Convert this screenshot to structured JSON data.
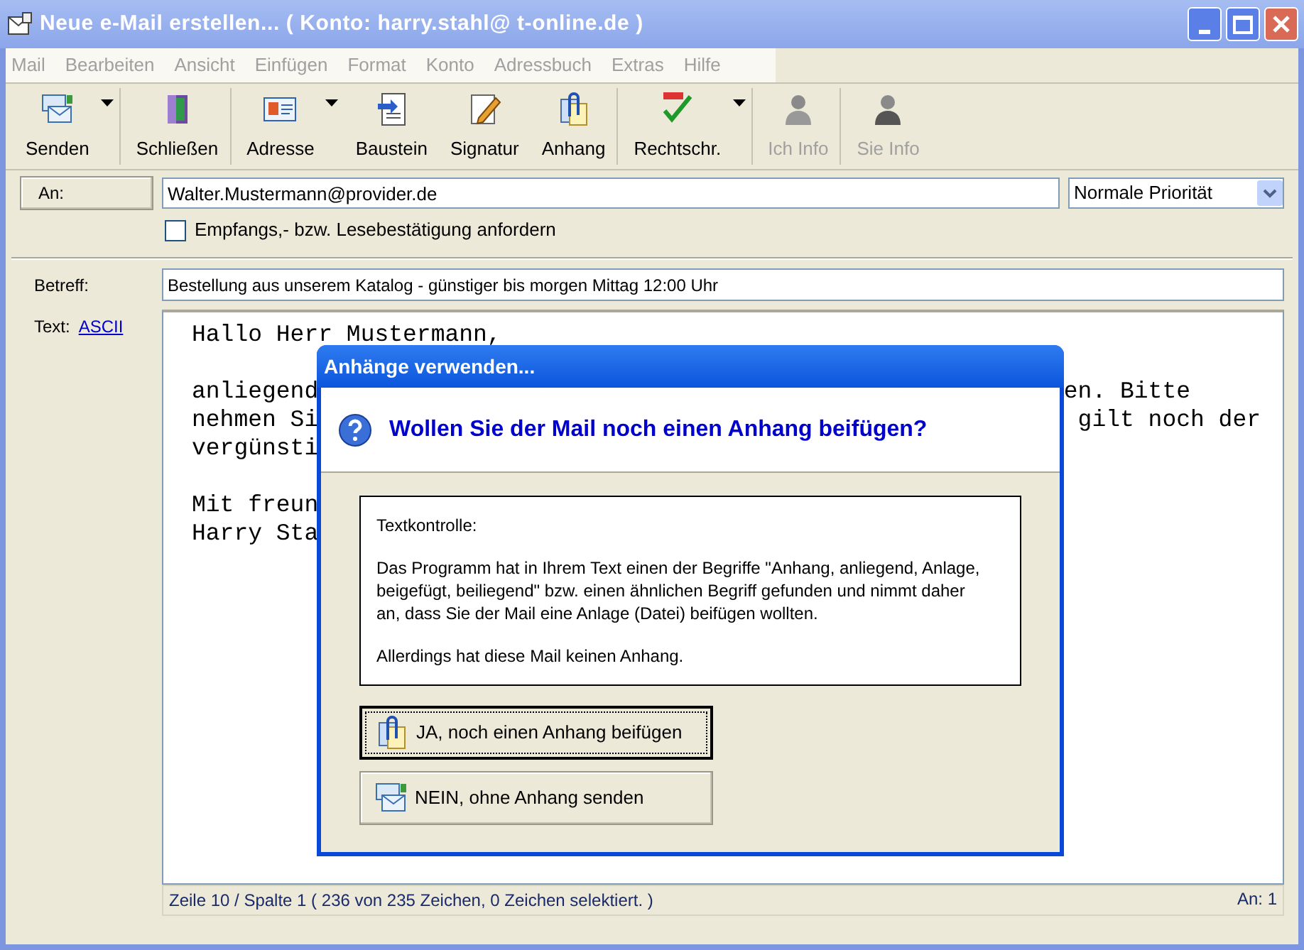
{
  "window": {
    "title": "Neue e-Mail erstellen... ( Konto: harry.stahl@ t-online.de )"
  },
  "menu": [
    {
      "label": "Mail",
      "disabled": true
    },
    {
      "label": "Bearbeiten",
      "disabled": true
    },
    {
      "label": "Ansicht",
      "disabled": true
    },
    {
      "label": "Einfügen",
      "disabled": true
    },
    {
      "label": "Format",
      "disabled": true
    },
    {
      "label": "Konto",
      "disabled": true
    },
    {
      "label": "Adressbuch",
      "disabled": true
    },
    {
      "label": "Extras",
      "disabled": true
    },
    {
      "label": "Hilfe",
      "disabled": true
    }
  ],
  "toolbar": [
    {
      "label": "Senden",
      "dropdown": true,
      "disabled": false
    },
    {
      "label": "Schließen",
      "dropdown": false,
      "disabled": false
    },
    {
      "label": "Adresse",
      "dropdown": true,
      "disabled": false
    },
    {
      "label": "Baustein",
      "dropdown": false,
      "disabled": false
    },
    {
      "label": "Signatur",
      "dropdown": false,
      "disabled": false
    },
    {
      "label": "Anhang",
      "dropdown": false,
      "disabled": false
    },
    {
      "label": "Rechtschr.",
      "dropdown": true,
      "disabled": false
    },
    {
      "label": "Ich Info",
      "dropdown": false,
      "disabled": true
    },
    {
      "label": "Sie Info",
      "dropdown": false,
      "disabled": true
    }
  ],
  "to": {
    "button": "An:",
    "value": "Walter.Mustermann@provider.de",
    "priority": "Normale Priorität"
  },
  "receipt": {
    "label": "Empfangs,- bzw. Lesebestätigung anfordern",
    "checked": false
  },
  "subject": {
    "label": "Betreff:",
    "value": "Bestellung aus unserem Katalog - günstiger bis morgen Mittag 12:00 Uhr"
  },
  "text": {
    "label": "Text:",
    "format_link": "ASCII",
    "lines": [
      {
        "kind": "text",
        "left": "Hallo Herr Mustermann,"
      },
      {
        "kind": "blank"
      },
      {
        "kind": "text",
        "left": "anliegend",
        "right": "en. Bitte"
      },
      {
        "kind": "text",
        "left": "nehmen Si",
        "right": " gilt noch der"
      },
      {
        "kind": "text",
        "left": "vergünsti"
      },
      {
        "kind": "blank"
      },
      {
        "kind": "text",
        "left": "Mit freun"
      },
      {
        "kind": "text",
        "left": "Harry Sta"
      }
    ]
  },
  "status_bar": {
    "position": "Zeile 10 / Spalte 1 ( 236 von 235 Zeichen, 0 Zeichen selektiert. )",
    "recipients": "An: 1"
  },
  "dialog": {
    "title": "Anhänge verwenden...",
    "question": "Wollen Sie der Mail noch einen Anhang beifügen?",
    "message": [
      "Textkontrolle:",
      "Das Programm hat in Ihrem Text einen der Begriffe \"Anhang, anliegend, Anlage, beigefügt, beiliegend\" bzw. einen ähnlichen Begriff gefunden und nimmt daher an, dass Sie der Mail eine Anlage (Datei) beifügen wollten.",
      "Allerdings hat diese Mail keinen Anhang."
    ],
    "buttons": [
      {
        "label": "JA, noch einen Anhang beifügen",
        "focused": true
      },
      {
        "label": "NEIN, ohne Anhang senden",
        "focused": false
      }
    ]
  }
}
